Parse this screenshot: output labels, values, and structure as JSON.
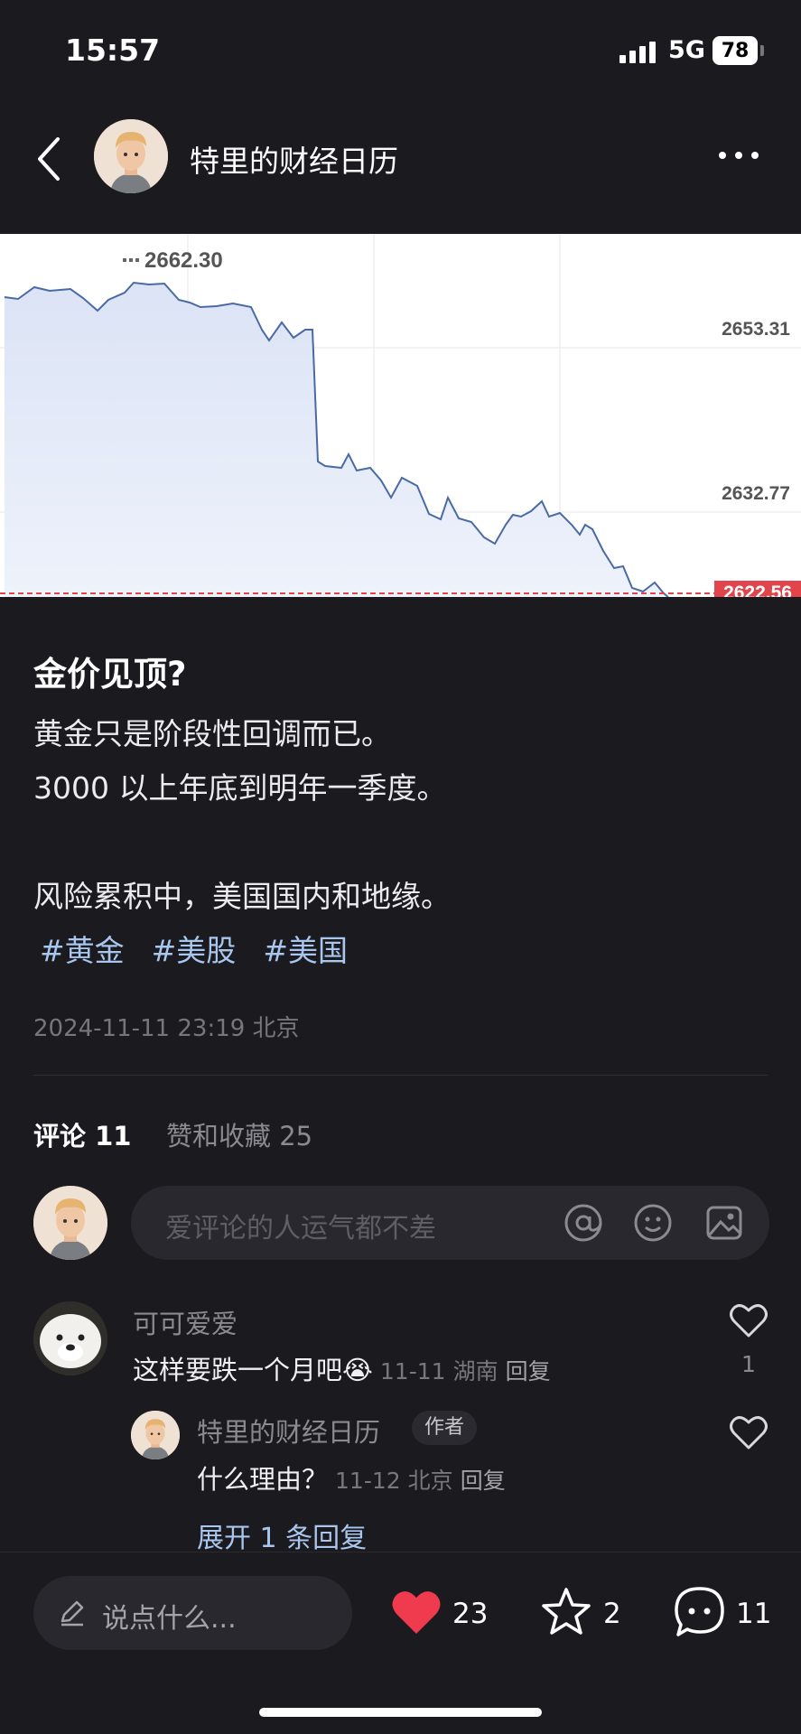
{
  "status_bar": {
    "time": "15:57",
    "network": "5G",
    "battery": "78"
  },
  "nav": {
    "back_icon": "chevron-left-icon",
    "title": "特里的财经日历",
    "more_icon": "more-horizontal-icon"
  },
  "chart_preview": {
    "peak_label": "2662.30",
    "y_labels": [
      "2653.31",
      "2632.77"
    ],
    "current_price": "2622.56",
    "line_color": "#4a6aa5",
    "marker_color": "#e1454b"
  },
  "post": {
    "title": "金价见顶?",
    "lines": [
      "黄金只是阶段性回调而已。",
      "3000 以上年底到明年一季度。",
      "风险累积中，美国国内和地缘。"
    ],
    "tags": [
      "#黄金",
      "#美股",
      "#美国"
    ],
    "meta": "2024-11-11 23:19 北京"
  },
  "tabs": {
    "comments": "评论 11",
    "likes_favs": "赞和收藏 25"
  },
  "comment_input": {
    "placeholder": "爱评论的人运气都不差",
    "icons": [
      "at-icon",
      "emoji-icon",
      "image-icon"
    ]
  },
  "comments": [
    {
      "name": "可可爱爱",
      "text": "这样要跌一个月吧",
      "emoji": "😭",
      "date": "11-11",
      "location": "湖南",
      "reply_label": "回复",
      "likes": "1"
    },
    {
      "name": "特里的财经日历",
      "badge": "作者",
      "text": "什么理由？",
      "date": "11-12",
      "location": "北京",
      "reply_label": "回复"
    }
  ],
  "expand_replies": "展开 1 条回复",
  "bottom_bar": {
    "say_placeholder": "说点什么...",
    "likes": "23",
    "favorites": "2",
    "comments": "11",
    "like_color": "#f03a4d"
  }
}
